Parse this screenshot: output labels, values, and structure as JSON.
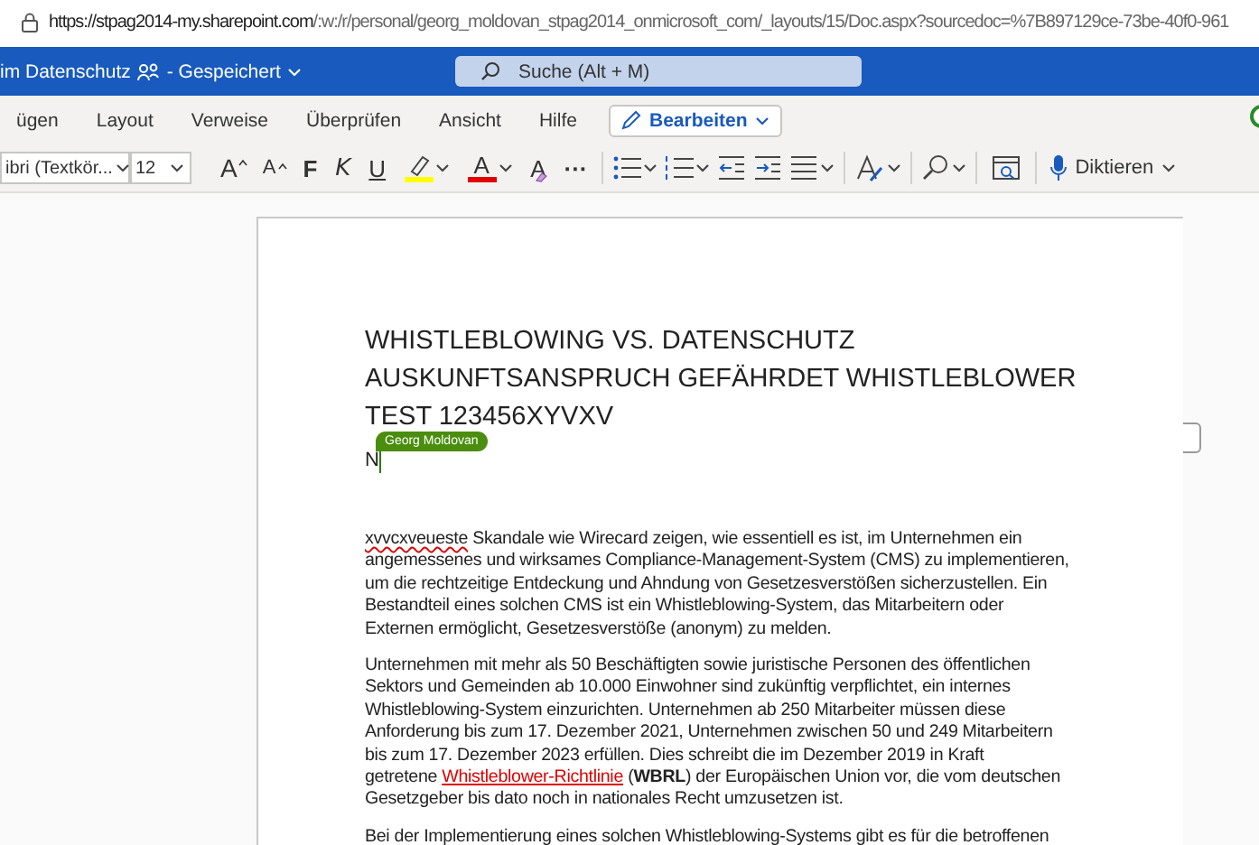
{
  "address_bar": {
    "url_host": "https://stpag2014-my.sharepoint.com",
    "url_path": "/:w:/r/personal/georg_moldovan_stpag2014_onmicrosoft_com/_layouts/15/Doc.aspx?sourcedoc=%7B897129ce-73be-40f0-961"
  },
  "header": {
    "document_title": "im Datenschutz",
    "save_status": "- Gespeichert",
    "search": {
      "placeholder": "Suche (Alt + M)"
    }
  },
  "ribbon_tabs": [
    {
      "label": "ügen",
      "kind": "tab"
    },
    {
      "label": "Layout",
      "kind": "tab"
    },
    {
      "label": "Verweise",
      "kind": "tab"
    },
    {
      "label": "Überprüfen",
      "kind": "tab"
    },
    {
      "label": "Ansicht",
      "kind": "tab"
    },
    {
      "label": "Hilfe",
      "kind": "tab"
    },
    {
      "label": "Bearbeiten",
      "kind": "mode"
    }
  ],
  "toolbar": [
    {
      "kind": "font",
      "value": "ibri (Textkör..."
    },
    {
      "kind": "size",
      "value": "12"
    },
    {
      "kind": "grow",
      "label": "A"
    },
    {
      "kind": "shrink",
      "label": "A"
    },
    {
      "kind": "bold",
      "label": "F"
    },
    {
      "kind": "italic",
      "label": "K"
    },
    {
      "kind": "underline",
      "label": "U"
    },
    {
      "kind": "highlight",
      "color": "#ffff00"
    },
    {
      "kind": "fontcolor",
      "label": "A",
      "color": "#e00000"
    },
    {
      "kind": "clear",
      "label": "A"
    },
    {
      "kind": "more",
      "label": "···"
    },
    {
      "kind": "bullets"
    },
    {
      "kind": "numbering"
    },
    {
      "kind": "outdent"
    },
    {
      "kind": "indent"
    },
    {
      "kind": "align"
    },
    {
      "kind": "styles"
    },
    {
      "kind": "find"
    },
    {
      "kind": "reader"
    },
    {
      "kind": "dictate",
      "label": "Diktieren"
    }
  ],
  "document": {
    "title_lines": [
      "WHISTLEBLOWING VS. DATENSCHUTZ",
      "AUSKUNFTSANSPRUCH GEFÄHRDET WHISTLEBLOWER",
      "TEST 123456XYVXV"
    ],
    "cursor_line": "N",
    "collaborator": "Georg Moldovan",
    "paragraphs": [
      {
        "lines": [
          [
            {
              "kind": "misspelled",
              "text": "xvvcxveueste"
            },
            {
              "kind": "text",
              "text": " Skandale wie Wirecard zeigen, wie essentiell es ist, im Unternehmen ein"
            }
          ],
          [
            {
              "kind": "text",
              "text": "angemessenes und wirksames Compliance-Management-System (CMS) zu implementieren,"
            }
          ],
          [
            {
              "kind": "text",
              "text": "um die rechtzeitige Entdeckung und Ahndung von Gesetzesverstößen sicherzustellen. Ein"
            }
          ],
          [
            {
              "kind": "text",
              "text": "Bestandteil eines solchen CMS ist ein Whistleblowing-System, das Mitarbeitern oder"
            }
          ],
          [
            {
              "kind": "text",
              "text": "Externen ermöglicht, Gesetzesverstöße (anonym) zu melden."
            }
          ]
        ]
      },
      {
        "lines": [
          [
            {
              "kind": "text",
              "text": "Unternehmen mit mehr als 50 Beschäftigten sowie juristische Personen des öffentlichen"
            }
          ],
          [
            {
              "kind": "text",
              "text": "Sektors und Gemeinden ab 10.000 Einwohner sind zukünftig verpflichtet, ein internes"
            }
          ],
          [
            {
              "kind": "text",
              "text": "Whistleblowing-System einzurichten. Unternehmen ab 250 Mitarbeiter müssen diese"
            }
          ],
          [
            {
              "kind": "text",
              "text": "Anforderung bis zum 17. Dezember 2021, Unternehmen zwischen 50 und 249 Mitarbeitern"
            }
          ],
          [
            {
              "kind": "text",
              "text": "bis zum 17. Dezember 2023 erfüllen. Dies schreibt die im Dezember 2019 in Kraft"
            }
          ],
          [
            {
              "kind": "text",
              "text": "getretene "
            },
            {
              "kind": "link",
              "text": "Whistleblower-Richtlinie"
            },
            {
              "kind": "text",
              "text": " (**WBRL**) der Europäischen Union vor, die vom deutschen"
            }
          ],
          [
            {
              "kind": "text",
              "text": "Gesetzgeber bis dato noch in nationales Recht umzusetzen ist."
            }
          ]
        ]
      },
      {
        "lines": [
          [
            {
              "kind": "text",
              "text": "Bei der Implementierung eines solchen Whistleblowing-Systems gibt es für die betroffenen"
            }
          ]
        ]
      }
    ]
  }
}
